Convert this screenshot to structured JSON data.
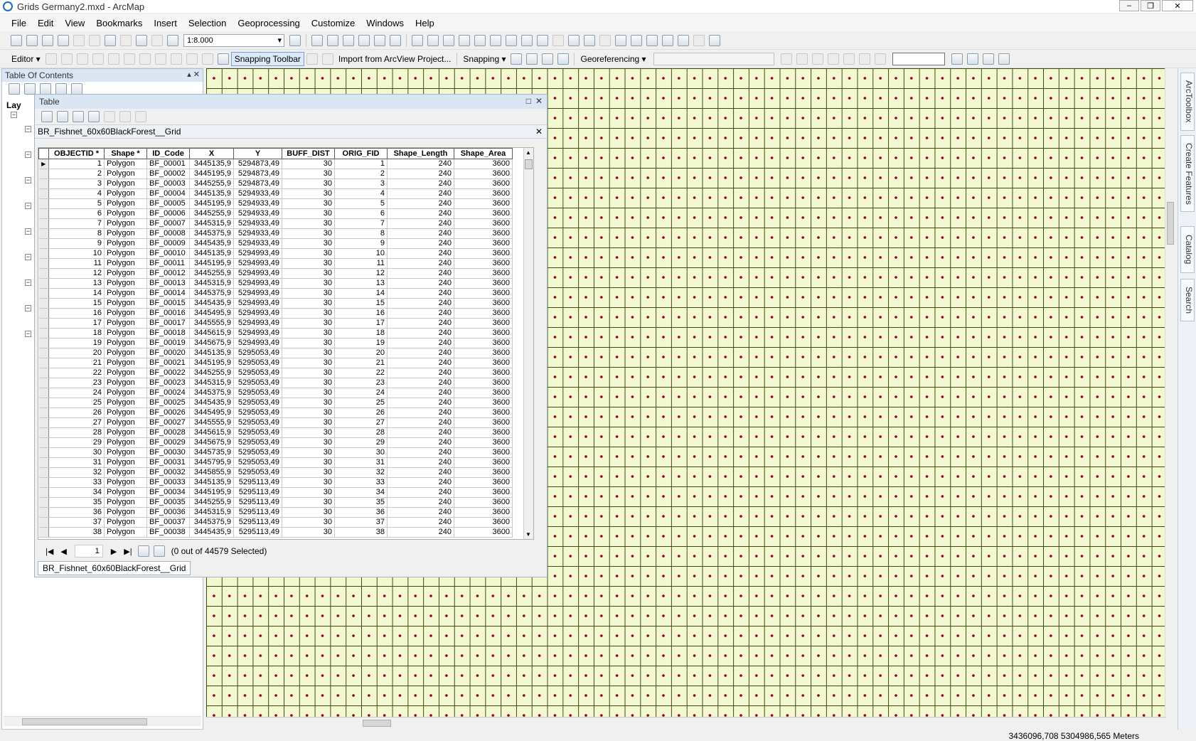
{
  "window": {
    "title": "Grids Germany2.mxd - ArcMap",
    "minimize": "–",
    "maximize": "❐",
    "close": "✕"
  },
  "menu": [
    "File",
    "Edit",
    "View",
    "Bookmarks",
    "Insert",
    "Selection",
    "Geoprocessing",
    "Customize",
    "Windows",
    "Help"
  ],
  "toolbar": {
    "scale": "1:8.000",
    "editor_label": "Editor ▾",
    "snapping_toolbar_label": "Snapping Toolbar",
    "import_label": "Import from ArcView Project...",
    "snapping_label": "Snapping ▾",
    "georef_label": "Georeferencing ▾"
  },
  "toc": {
    "title": "Table Of Contents",
    "pin": "▴ ✕",
    "layers_label": "Lay"
  },
  "table_window": {
    "title": "Table",
    "layer_name": "BR_Fishnet_60x60BlackForest__Grid",
    "columns": [
      "OBJECTID *",
      "Shape *",
      "ID_Code",
      "X",
      "Y",
      "BUFF_DIST",
      "ORIG_FID",
      "Shape_Length",
      "Shape_Area"
    ],
    "rows": [
      [
        "1",
        "Polygon",
        "BF_00001",
        "3445135,9",
        "5294873,49",
        "30",
        "1",
        "240",
        "3600"
      ],
      [
        "2",
        "Polygon",
        "BF_00002",
        "3445195,9",
        "5294873,49",
        "30",
        "2",
        "240",
        "3600"
      ],
      [
        "3",
        "Polygon",
        "BF_00003",
        "3445255,9",
        "5294873,49",
        "30",
        "3",
        "240",
        "3600"
      ],
      [
        "4",
        "Polygon",
        "BF_00004",
        "3445135,9",
        "5294933,49",
        "30",
        "4",
        "240",
        "3600"
      ],
      [
        "5",
        "Polygon",
        "BF_00005",
        "3445195,9",
        "5294933,49",
        "30",
        "5",
        "240",
        "3600"
      ],
      [
        "6",
        "Polygon",
        "BF_00006",
        "3445255,9",
        "5294933,49",
        "30",
        "6",
        "240",
        "3600"
      ],
      [
        "7",
        "Polygon",
        "BF_00007",
        "3445315,9",
        "5294933,49",
        "30",
        "7",
        "240",
        "3600"
      ],
      [
        "8",
        "Polygon",
        "BF_00008",
        "3445375,9",
        "5294933,49",
        "30",
        "8",
        "240",
        "3600"
      ],
      [
        "9",
        "Polygon",
        "BF_00009",
        "3445435,9",
        "5294933,49",
        "30",
        "9",
        "240",
        "3600"
      ],
      [
        "10",
        "Polygon",
        "BF_00010",
        "3445135,9",
        "5294993,49",
        "30",
        "10",
        "240",
        "3600"
      ],
      [
        "11",
        "Polygon",
        "BF_00011",
        "3445195,9",
        "5294993,49",
        "30",
        "11",
        "240",
        "3600"
      ],
      [
        "12",
        "Polygon",
        "BF_00012",
        "3445255,9",
        "5294993,49",
        "30",
        "12",
        "240",
        "3600"
      ],
      [
        "13",
        "Polygon",
        "BF_00013",
        "3445315,9",
        "5294993,49",
        "30",
        "13",
        "240",
        "3600"
      ],
      [
        "14",
        "Polygon",
        "BF_00014",
        "3445375,9",
        "5294993,49",
        "30",
        "14",
        "240",
        "3600"
      ],
      [
        "15",
        "Polygon",
        "BF_00015",
        "3445435,9",
        "5294993,49",
        "30",
        "15",
        "240",
        "3600"
      ],
      [
        "16",
        "Polygon",
        "BF_00016",
        "3445495,9",
        "5294993,49",
        "30",
        "16",
        "240",
        "3600"
      ],
      [
        "17",
        "Polygon",
        "BF_00017",
        "3445555,9",
        "5294993,49",
        "30",
        "17",
        "240",
        "3600"
      ],
      [
        "18",
        "Polygon",
        "BF_00018",
        "3445615,9",
        "5294993,49",
        "30",
        "18",
        "240",
        "3600"
      ],
      [
        "19",
        "Polygon",
        "BF_00019",
        "3445675,9",
        "5294993,49",
        "30",
        "19",
        "240",
        "3600"
      ],
      [
        "20",
        "Polygon",
        "BF_00020",
        "3445135,9",
        "5295053,49",
        "30",
        "20",
        "240",
        "3600"
      ],
      [
        "21",
        "Polygon",
        "BF_00021",
        "3445195,9",
        "5295053,49",
        "30",
        "21",
        "240",
        "3600"
      ],
      [
        "22",
        "Polygon",
        "BF_00022",
        "3445255,9",
        "5295053,49",
        "30",
        "22",
        "240",
        "3600"
      ],
      [
        "23",
        "Polygon",
        "BF_00023",
        "3445315,9",
        "5295053,49",
        "30",
        "23",
        "240",
        "3600"
      ],
      [
        "24",
        "Polygon",
        "BF_00024",
        "3445375,9",
        "5295053,49",
        "30",
        "24",
        "240",
        "3600"
      ],
      [
        "25",
        "Polygon",
        "BF_00025",
        "3445435,9",
        "5295053,49",
        "30",
        "25",
        "240",
        "3600"
      ],
      [
        "26",
        "Polygon",
        "BF_00026",
        "3445495,9",
        "5295053,49",
        "30",
        "26",
        "240",
        "3600"
      ],
      [
        "27",
        "Polygon",
        "BF_00027",
        "3445555,9",
        "5295053,49",
        "30",
        "27",
        "240",
        "3600"
      ],
      [
        "28",
        "Polygon",
        "BF_00028",
        "3445615,9",
        "5295053,49",
        "30",
        "28",
        "240",
        "3600"
      ],
      [
        "29",
        "Polygon",
        "BF_00029",
        "3445675,9",
        "5295053,49",
        "30",
        "29",
        "240",
        "3600"
      ],
      [
        "30",
        "Polygon",
        "BF_00030",
        "3445735,9",
        "5295053,49",
        "30",
        "30",
        "240",
        "3600"
      ],
      [
        "31",
        "Polygon",
        "BF_00031",
        "3445795,9",
        "5295053,49",
        "30",
        "31",
        "240",
        "3600"
      ],
      [
        "32",
        "Polygon",
        "BF_00032",
        "3445855,9",
        "5295053,49",
        "30",
        "32",
        "240",
        "3600"
      ],
      [
        "33",
        "Polygon",
        "BF_00033",
        "3445135,9",
        "5295113,49",
        "30",
        "33",
        "240",
        "3600"
      ],
      [
        "34",
        "Polygon",
        "BF_00034",
        "3445195,9",
        "5295113,49",
        "30",
        "34",
        "240",
        "3600"
      ],
      [
        "35",
        "Polygon",
        "BF_00035",
        "3445255,9",
        "5295113,49",
        "30",
        "35",
        "240",
        "3600"
      ],
      [
        "36",
        "Polygon",
        "BF_00036",
        "3445315,9",
        "5295113,49",
        "30",
        "36",
        "240",
        "3600"
      ],
      [
        "37",
        "Polygon",
        "BF_00037",
        "3445375,9",
        "5295113,49",
        "30",
        "37",
        "240",
        "3600"
      ],
      [
        "38",
        "Polygon",
        "BF_00038",
        "3445435,9",
        "5295113,49",
        "30",
        "38",
        "240",
        "3600"
      ]
    ],
    "record": "1",
    "selection_status": "(0 out of 44579 Selected)",
    "tab_label": "BR_Fishnet_60x60BlackForest__Grid"
  },
  "dock_tabs": [
    "ArcToolbox",
    "Create Features",
    "Catalog",
    "Search"
  ],
  "status": {
    "coords": "3436096,708  5304986,565 Meters"
  },
  "colors": {
    "map_fill": "#f4f8d0",
    "grid_line": "#3b4a14",
    "point": "#8b0a2a",
    "panel_header": "#dbe6f4"
  }
}
